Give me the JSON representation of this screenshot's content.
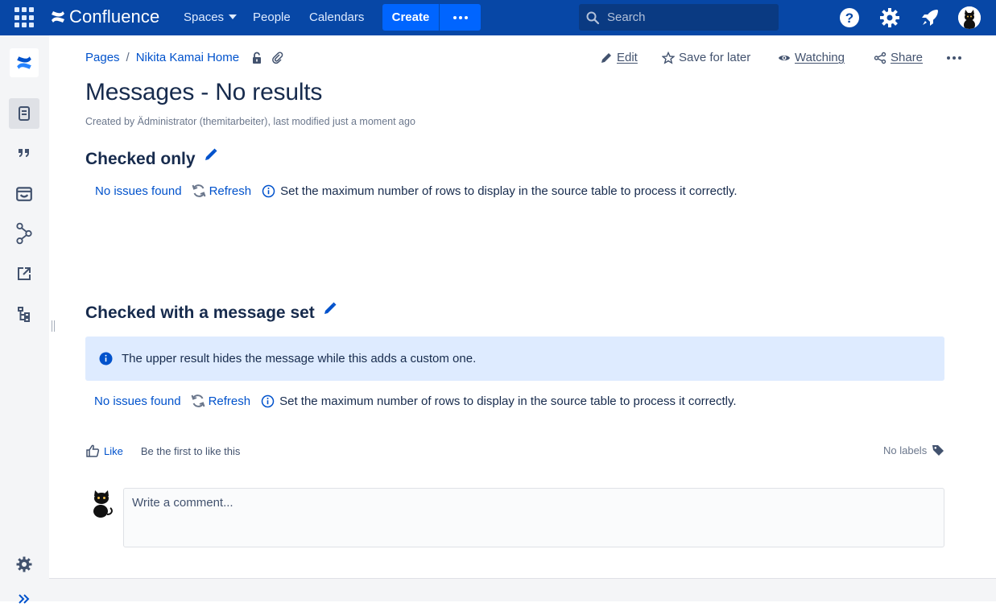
{
  "topnav": {
    "logo_text": "Confluence",
    "items": [
      "Spaces",
      "People",
      "Calendars"
    ],
    "create_label": "Create",
    "search_placeholder": "Search"
  },
  "breadcrumb": {
    "items": [
      "Pages",
      "Nikita Kamai Home"
    ]
  },
  "actions": {
    "edit": "Edit",
    "save_for_later": "Save for later",
    "watching": "Watching",
    "share": "Share"
  },
  "page": {
    "title": "Messages - No results",
    "byline": "Created by Ädministrator (themitarbeiter), last modified just a moment ago"
  },
  "sections": [
    {
      "heading": "Checked only",
      "result_link": "No issues found",
      "refresh": "Refresh",
      "note": "Set the maximum number of rows to display in the source table to process it correctly."
    },
    {
      "heading": "Checked with a message set",
      "panel_text": "The upper result hides the message while this adds a custom one.",
      "result_link": "No issues found",
      "refresh": "Refresh",
      "note": "Set the maximum number of rows to display in the source table to process it correctly."
    }
  ],
  "footer": {
    "like": "Like",
    "like_text": "Be the first to like this",
    "labels": "No labels",
    "comment_placeholder": "Write a comment..."
  },
  "colors": {
    "nav_bg": "#0747a6",
    "accent": "#0052cc",
    "panel_bg": "#deebff"
  }
}
